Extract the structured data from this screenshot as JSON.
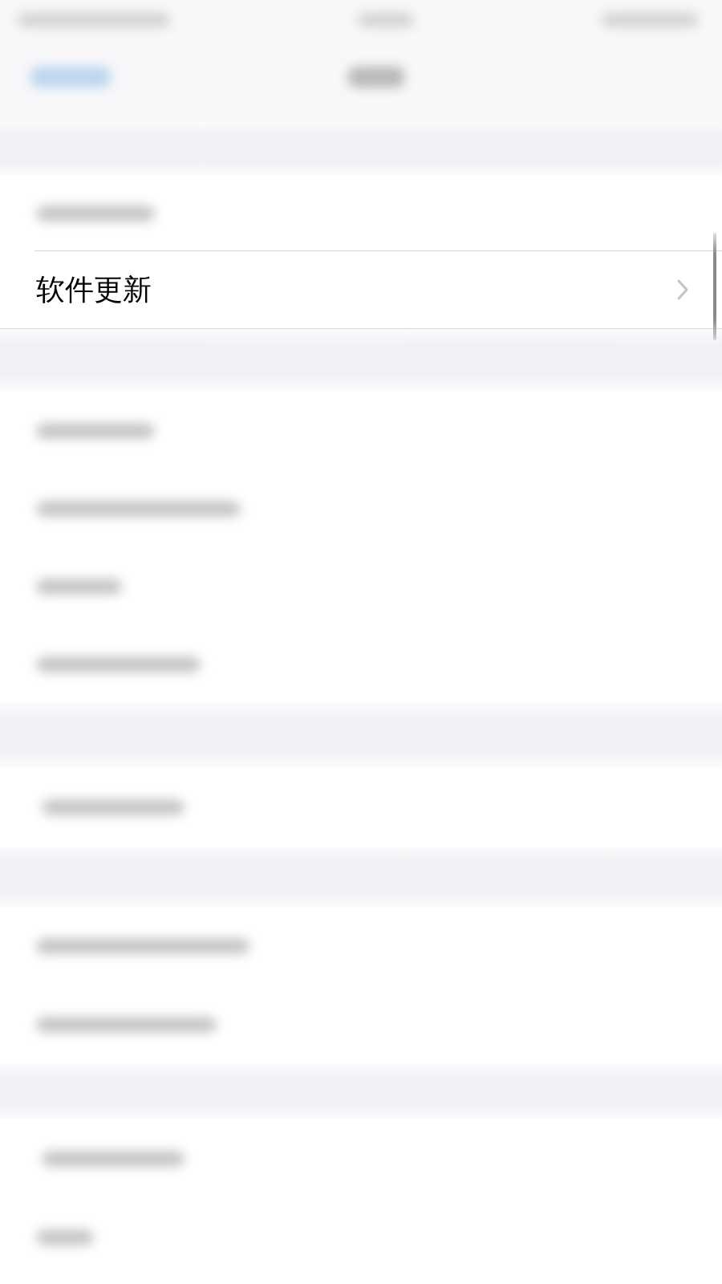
{
  "settings_list": {
    "rows": [
      {
        "label": "软件更新"
      }
    ]
  }
}
